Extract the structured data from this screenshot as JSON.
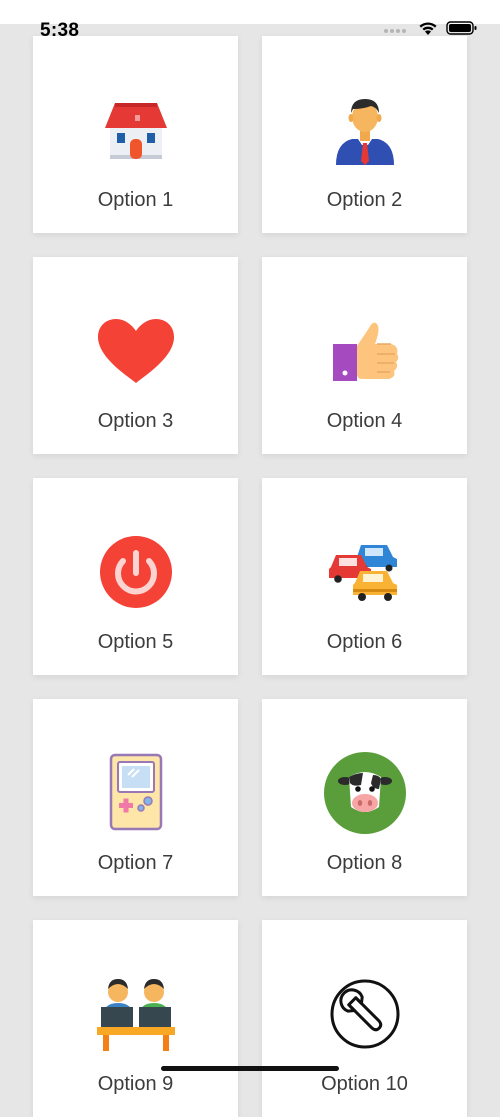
{
  "status": {
    "time": "5:38"
  },
  "options": [
    {
      "label": "Option 1",
      "icon": "house-icon"
    },
    {
      "label": "Option 2",
      "icon": "businessman-icon"
    },
    {
      "label": "Option 3",
      "icon": "heart-icon"
    },
    {
      "label": "Option 4",
      "icon": "thumbs-up-icon"
    },
    {
      "label": "Option 5",
      "icon": "power-icon"
    },
    {
      "label": "Option 6",
      "icon": "traffic-cars-icon"
    },
    {
      "label": "Option 7",
      "icon": "game-console-icon"
    },
    {
      "label": "Option 8",
      "icon": "cow-icon"
    },
    {
      "label": "Option 9",
      "icon": "coworkers-icon"
    },
    {
      "label": "Option 10",
      "icon": "wrench-icon"
    }
  ]
}
